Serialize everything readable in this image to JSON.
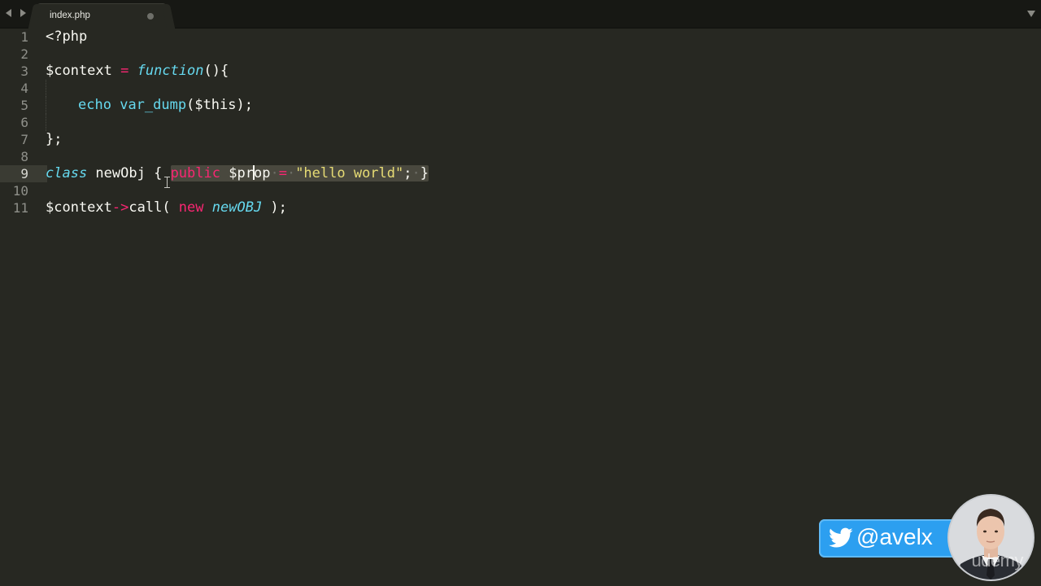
{
  "tabbar": {
    "active_tab": {
      "label": "index.php",
      "dirty": true
    }
  },
  "editor": {
    "active_line": 9,
    "line_numbers": [
      "1",
      "2",
      "3",
      "4",
      "5",
      "6",
      "7",
      "8",
      "9",
      "10",
      "11"
    ],
    "lines": [
      {
        "number": "1",
        "tokens": [
          {
            "t": "<?php",
            "c": "punc"
          }
        ]
      },
      {
        "number": "2",
        "tokens": []
      },
      {
        "number": "3",
        "tokens": [
          {
            "t": "$context",
            "c": "var"
          },
          {
            "t": " = ",
            "c": "op"
          },
          {
            "t": "function",
            "c": "storage"
          },
          {
            "t": "(){",
            "c": "punc"
          }
        ]
      },
      {
        "number": "4",
        "tokens": []
      },
      {
        "number": "5",
        "tokens": [
          {
            "t": "echo",
            "c": "fn"
          },
          {
            "t": " ",
            "c": "punc"
          },
          {
            "t": "var_dump",
            "c": "fn"
          },
          {
            "t": "($this);",
            "c": "punc"
          }
        ]
      },
      {
        "number": "6",
        "tokens": []
      },
      {
        "number": "7",
        "tokens": [
          {
            "t": "};",
            "c": "punc"
          }
        ]
      },
      {
        "number": "8",
        "tokens": []
      },
      {
        "number": "9",
        "tokens": [
          {
            "t": "class",
            "c": "storage"
          },
          {
            "t": " newObj {",
            "c": "punc"
          }
        ]
      },
      {
        "number": "10",
        "tokens": []
      },
      {
        "number": "11",
        "tokens": [
          {
            "t": "$context",
            "c": "var"
          },
          {
            "t": "->",
            "c": "op"
          },
          {
            "t": "call( ",
            "c": "punc"
          },
          {
            "t": "new",
            "c": "kw"
          },
          {
            "t": " ",
            "c": "punc"
          },
          {
            "t": "newOBJ",
            "c": "type"
          },
          {
            "t": " );",
            "c": "punc"
          }
        ]
      }
    ],
    "selection_line_9": {
      "kw": "public",
      "var_before_caret": "$pr",
      "var_after_caret": "op",
      "op": "=",
      "str": "\"hello world\"",
      "tail": ";",
      "close": "}"
    }
  },
  "overlay": {
    "twitter_handle": "@avelx",
    "twitter_icon": "twitter-bird-icon",
    "watermark": "udemy",
    "colors": {
      "badge": "#2c9ff0"
    }
  }
}
